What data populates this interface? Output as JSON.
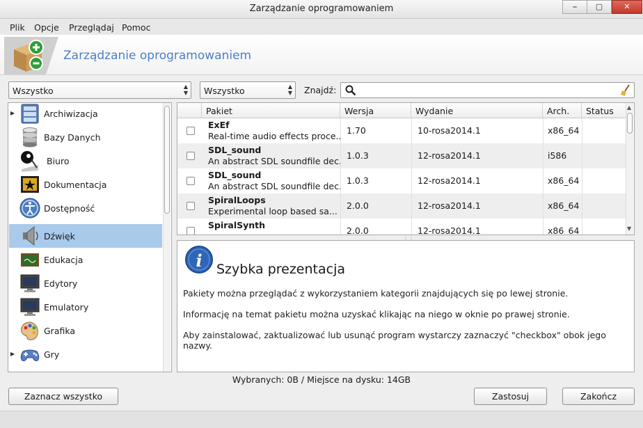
{
  "window": {
    "title": "Zarządzanie oprogramowaniem",
    "buttons": [
      "⎯",
      "▢",
      "✕"
    ]
  },
  "menu": [
    "Plik",
    "Opcje",
    "Przeglądaj",
    "Pomoc"
  ],
  "header": {
    "title": "Zarządzanie oprogramowaniem"
  },
  "filters": {
    "category": "Wszystko",
    "status": "Wszystko",
    "find_label": "Znajdź:",
    "search_value": ""
  },
  "categories": [
    {
      "label": "Archiwizacja",
      "expandable": true,
      "selected": false,
      "icon": "archive-icon"
    },
    {
      "label": "Bazy Danych",
      "expandable": false,
      "selected": false,
      "icon": "database-icon"
    },
    {
      "label": "Biuro",
      "expandable": false,
      "selected": false,
      "icon": "office-icon"
    },
    {
      "label": "Dokumentacja",
      "expandable": false,
      "selected": false,
      "icon": "documentation-icon"
    },
    {
      "label": "Dostępność",
      "expandable": false,
      "selected": false,
      "icon": "accessibility-icon"
    },
    {
      "label": "Dźwięk",
      "expandable": false,
      "selected": true,
      "icon": "speaker-icon"
    },
    {
      "label": "Edukacja",
      "expandable": false,
      "selected": false,
      "icon": "chalkboard-icon"
    },
    {
      "label": "Edytory",
      "expandable": false,
      "selected": false,
      "icon": "monitor-icon"
    },
    {
      "label": "Emulatory",
      "expandable": false,
      "selected": false,
      "icon": "monitor-icon"
    },
    {
      "label": "Grafika",
      "expandable": false,
      "selected": false,
      "icon": "palette-icon"
    },
    {
      "label": "Gry",
      "expandable": true,
      "selected": false,
      "icon": "gamepad-icon"
    }
  ],
  "table": {
    "columns": [
      "Pakiet",
      "Wersja",
      "Wydanie",
      "Arch.",
      "Status"
    ],
    "rows": [
      {
        "name": "ExEf",
        "desc": "Real-time audio effects proce...",
        "version": "1.70",
        "release": "10-rosa2014.1",
        "arch": "x86_64",
        "status": ""
      },
      {
        "name": "SDL_sound",
        "desc": "An abstract SDL soundfile dec...",
        "version": "1.0.3",
        "release": "12-rosa2014.1",
        "arch": "i586",
        "status": ""
      },
      {
        "name": "SDL_sound",
        "desc": "An abstract SDL soundfile dec...",
        "version": "1.0.3",
        "release": "12-rosa2014.1",
        "arch": "x86_64",
        "status": ""
      },
      {
        "name": "SpiralLoops",
        "desc": "Experimental loop based sa...",
        "version": "2.0.0",
        "release": "12-rosa2014.1",
        "arch": "x86_64",
        "status": ""
      },
      {
        "name": "SpiralSynth",
        "desc": "",
        "version": "2.0.0",
        "release": "12-rosa2014.1",
        "arch": "x86_64",
        "status": ""
      }
    ]
  },
  "info": {
    "title": "Szybka prezentacja",
    "lines": [
      "Pakiety można przeglądać z wykorzystaniem kategorii znajdujących się po lewej stronie.",
      "Informację na temat pakietu można uzyskać klikając na niego w oknie po prawej stronie.",
      "Aby zainstalować, zaktualizować lub usunąć program wystarczy zaznaczyć \"checkbox\" obok jego nazwy."
    ]
  },
  "status_text": "Wybranych: 0B / Miejsce na dysku: 14GB",
  "buttons": {
    "select_all": "Zaznacz wszystko",
    "apply": "Zastosuj",
    "quit": "Zakończ"
  }
}
